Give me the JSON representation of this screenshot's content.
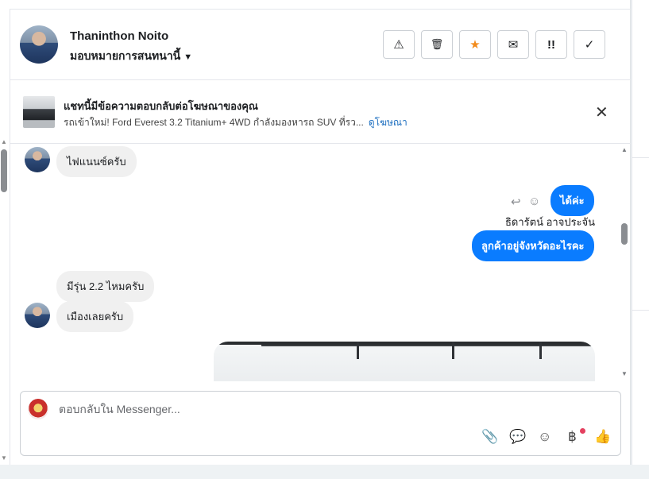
{
  "header": {
    "contact_name": "Thaninthon Noito",
    "assign_label": "มอบหมายการสนทนานี้",
    "tools": [
      {
        "name": "report-button",
        "glyph": "⚠"
      },
      {
        "name": "delete-button",
        "glyph": "🗑"
      },
      {
        "name": "star-button",
        "glyph": "★"
      },
      {
        "name": "mark-unread-button",
        "glyph": "✉"
      },
      {
        "name": "follow-up-button",
        "glyph": "!!"
      },
      {
        "name": "mark-done-button",
        "glyph": "✓"
      }
    ]
  },
  "ad_notice": {
    "title": "แชทนี้มีข้อความตอบกลับต่อโฆษณาของคุณ",
    "subtitle": "รถเข้าใหม่! Ford Everest 3.2 Titanium+ 4WD กำลังมองหารถ SUV ที่รว...",
    "link": "ดูโฆษณา"
  },
  "messages": {
    "m1": "ไฟแนนซ์ครับ",
    "m2": "ได้ค่ะ",
    "sender": "ธิดารัตน์ อาจประจัน",
    "m3": "ลูกค้าอยู่จังหวัดอะไรคะ",
    "m4": "มีรุ่น 2.2  ไหมครับ",
    "m5": "เมืองเลยครับ"
  },
  "composer": {
    "placeholder": "ตอบกลับใน Messenger...",
    "icons": [
      "attach-icon",
      "chat-icon",
      "emoji-icon",
      "baht-icon",
      "like-icon"
    ]
  },
  "colors": {
    "accent": "#0a7cff",
    "star": "#f28b1c",
    "link": "#1a6dbf",
    "notif": "#e4405f"
  }
}
